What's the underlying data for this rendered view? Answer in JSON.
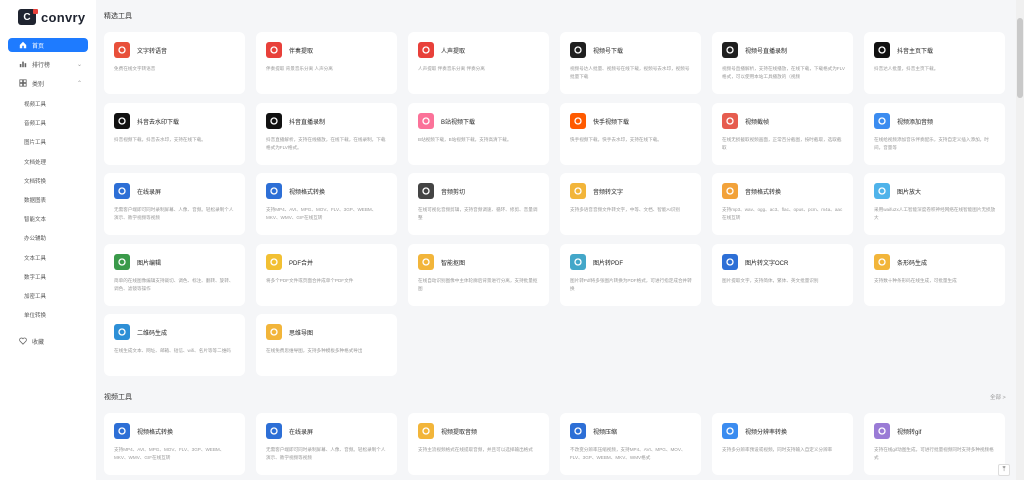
{
  "app": {
    "logo": "convry"
  },
  "sidebar": {
    "home": "首页",
    "ranking": "排行榜",
    "category": "类别",
    "categories": [
      "视频工具",
      "音频工具",
      "图片工具",
      "文档处理",
      "文档转换",
      "数据图表",
      "智能文本",
      "办公辅助",
      "文本工具",
      "数字工具",
      "加密工具",
      "单位转换"
    ],
    "favorites": "收藏"
  },
  "sections": [
    {
      "title": "精选工具",
      "more": "",
      "cards": [
        {
          "title": "文字转语音",
          "desc": "免费在线文字转语音",
          "icon": "text-to-speech-icon",
          "color": "#e8503a"
        },
        {
          "title": "伴奏提取",
          "desc": "伴奏提取 背景音乐分离 人声分离",
          "icon": "music-note-icon",
          "color": "#e8403a"
        },
        {
          "title": "人声提取",
          "desc": "人声提取 伴奏音乐分离 伴奏分离",
          "icon": "microphone-icon",
          "color": "#e8403a"
        },
        {
          "title": "视频号下载",
          "desc": "视频号达人批量、视频号在线下载，视频号去水印，视频号批量下载",
          "icon": "channels-icon",
          "color": "#1f1f1f"
        },
        {
          "title": "视频号直播录制",
          "desc": "视频号直播解析，支持在线播放，在线下载，下载格式为FLV格式，可以使用本站工具播放的（视频",
          "icon": "channels-icon",
          "color": "#1f1f1f"
        },
        {
          "title": "抖音主页下载",
          "desc": "抖音达人批量，抖音主页下载。",
          "icon": "tiktok-icon",
          "color": "#111"
        },
        {
          "title": "抖音去水印下载",
          "desc": "抖音视频下载，抖音去水印，支持在线下载。",
          "icon": "tiktok-icon",
          "color": "#111"
        },
        {
          "title": "抖音直播录制",
          "desc": "抖音直播解析，支持在线播放，在线下载，在线录制，下载格式为FLV格式。",
          "icon": "tiktok-icon",
          "color": "#111"
        },
        {
          "title": "B站视频下载",
          "desc": "B站视频下载，B站视频下载，支持高清下载。",
          "icon": "bilibili-icon",
          "color": "#fb7299"
        },
        {
          "title": "快手视频下载",
          "desc": "快手视频下载，快手去水印，支持在线下载。",
          "icon": "kuaishou-icon",
          "color": "#ff5a00"
        },
        {
          "title": "视频截帧",
          "desc": "在线无损截取视频画面，正常百分截图，按时截取，选取截取",
          "icon": "video-frame-icon",
          "color": "#e65c4f"
        },
        {
          "title": "视频添加音频",
          "desc": "在线给视频添加音乐伴奏配乐，支持自定义插入添加，时间，音量等",
          "icon": "calendar-add-icon",
          "color": "#3b8cf0"
        },
        {
          "title": "在线录屏",
          "desc": "无需客户端即可同时录制屏幕、人像、音频。轻松录制个人演示、教学视频等视频",
          "icon": "screen-record-icon",
          "color": "#2d6fd6"
        },
        {
          "title": "视频格式转换",
          "desc": "支持MP4、AVI、MPG、MOV、FLV、3GP、WEBM、MKV、WMV、GIF在线互转",
          "icon": "video-convert-icon",
          "color": "#2d6fd6"
        },
        {
          "title": "音频剪切",
          "desc": "在线可视化音频剪辑，支持音频调速、循环、修剪、音量调整",
          "icon": "scissors-icon",
          "color": "#444"
        },
        {
          "title": "音频转文字",
          "desc": "支持多语音音频文件转文字，中等、文档、智能AI识别",
          "icon": "audio-text-icon",
          "color": "#f2b53a"
        },
        {
          "title": "音频格式转换",
          "desc": "支持mp3、wav、ogg、ac3、flac、opus、pcm、m4a、aac在线互转",
          "icon": "music-note-icon",
          "color": "#f2a23a"
        },
        {
          "title": "图片放大",
          "desc": "采用waifu2x人工智能深度卷积神经网络在线智能图片无损放大",
          "icon": "image-enlarge-icon",
          "color": "#4fb3ea"
        },
        {
          "title": "图片编辑",
          "desc": "简单的在线图像编辑支持裁切、调色、标注、翻转、旋转、调色、滤镜等操作",
          "icon": "image-edit-icon",
          "color": "#3a9a4a"
        },
        {
          "title": "PDF合并",
          "desc": "将多个PDF文件或页面合并成单个PDF文件",
          "icon": "pdf-merge-icon",
          "color": "#f2c033"
        },
        {
          "title": "智能抠图",
          "desc": "在线自动识别图像中主体轮廓后背景进行分离，支持批量抠图",
          "icon": "smart-cutout-icon",
          "color": "#f2b53a"
        },
        {
          "title": "图片转PDF",
          "desc": "图片转Pdf将多张图片转换为PDF格式，可进行指定成合并转换",
          "icon": "image-pdf-icon",
          "color": "#43a7c9"
        },
        {
          "title": "图片转文字OCR",
          "desc": "图片提取文字，支持简体，繁体、英文批量识别",
          "icon": "ocr-icon",
          "color": "#2d6fd6"
        },
        {
          "title": "条形码生成",
          "desc": "支持数十种条形码在线生成，可批量生成",
          "icon": "barcode-icon",
          "color": "#f2b53a"
        },
        {
          "title": "二维码生成",
          "desc": "在线生成文本、网址、邮箱、短信、wifi、名片等等二维码",
          "icon": "qrcode-icon",
          "color": "#2d8fd6"
        },
        {
          "title": "思维导图",
          "desc": "在线免费思维导图，支持多种模板多种格式导出",
          "icon": "mindmap-icon",
          "color": "#f2b53a"
        }
      ]
    },
    {
      "title": "视频工具",
      "more": "全部 >",
      "cards": [
        {
          "title": "视频格式转换",
          "desc": "支持MP4、AVI、MPG、MOV、FLV、3GP、WEBM、MKV、WMV、GIF在线互转",
          "icon": "video-convert-icon",
          "color": "#2d6fd6"
        },
        {
          "title": "在线录屏",
          "desc": "无需客户端即可同时录制屏幕、人像、音频。轻松录制个人演示、教学视频等视频",
          "icon": "screen-record-icon",
          "color": "#2d6fd6"
        },
        {
          "title": "视频提取音频",
          "desc": "支持主流视频格式在线提取音频，并且可以选择输出格式",
          "icon": "video-audio-icon",
          "color": "#f2b53a"
        },
        {
          "title": "视频压缩",
          "desc": "不改变分辨率压缩视频，支持MP4、AVI、MPG、MOV、FLV、3GP、WEBM、MKV、WMV格式",
          "icon": "video-compress-icon",
          "color": "#2d6fd6"
        },
        {
          "title": "视频分辨率转换",
          "desc": "支持多分辨率预设或视频，同时支持输入自定义分辨率",
          "icon": "resolution-icon",
          "color": "#3b8cf0"
        },
        {
          "title": "视频转gif",
          "desc": "支持在线gif动图生成，可进行批量视频同时支持多种视频格式",
          "icon": "gif-icon",
          "color": "#9a7bd6"
        }
      ]
    }
  ]
}
